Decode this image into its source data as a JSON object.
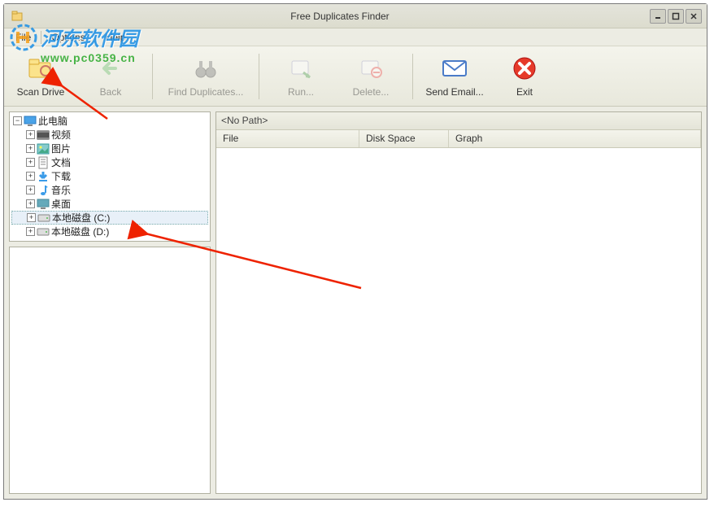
{
  "window": {
    "title": "Free Duplicates Finder"
  },
  "menubar": {
    "file": "File",
    "options": "Options",
    "help": "Help"
  },
  "toolbar": {
    "scan": "Scan Drive",
    "back": "Back",
    "find": "Find Duplicates...",
    "run": "Run...",
    "delete": "Delete...",
    "email": "Send Email...",
    "exit": "Exit"
  },
  "tree": {
    "root": "此电脑",
    "items": [
      {
        "label": "视频",
        "icon": "video"
      },
      {
        "label": "图片",
        "icon": "image"
      },
      {
        "label": "文档",
        "icon": "doc"
      },
      {
        "label": "下载",
        "icon": "download"
      },
      {
        "label": "音乐",
        "icon": "music"
      },
      {
        "label": "桌面",
        "icon": "desktop"
      },
      {
        "label": "本地磁盘 (C:)",
        "icon": "disk",
        "selected": true
      },
      {
        "label": "本地磁盘 (D:)",
        "icon": "disk"
      }
    ]
  },
  "path": "<No Path>",
  "columns": {
    "file": "File",
    "disk": "Disk Space",
    "graph": "Graph"
  },
  "watermark": {
    "text": "河东软件园",
    "url": "www.pc0359.cn"
  }
}
